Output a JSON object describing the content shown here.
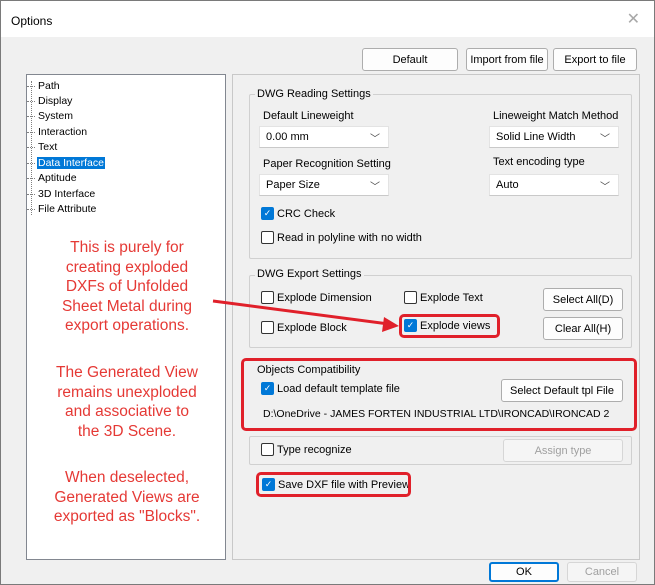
{
  "window": {
    "title": "Options"
  },
  "toolbar": {
    "default_label": "Default",
    "import_label": "Import from file",
    "export_label": "Export to file"
  },
  "tree": {
    "items": [
      {
        "label": "Path"
      },
      {
        "label": "Display"
      },
      {
        "label": "System"
      },
      {
        "label": "Interaction"
      },
      {
        "label": "Text"
      },
      {
        "label": "Data Interface"
      },
      {
        "label": "Aptitude"
      },
      {
        "label": "3D Interface"
      },
      {
        "label": "File Attribute"
      }
    ],
    "selected": "Data Interface"
  },
  "annotation": {
    "para1": [
      "This is purely for",
      "creating exploded",
      "DXFs of Unfolded",
      "Sheet Metal during",
      "export operations."
    ],
    "para2": [
      "The Generated View",
      "remains unexploded",
      "and associative to",
      "the 3D Scene."
    ],
    "para3": [
      "When deselected,",
      "Generated Views are",
      "exported as \"Blocks\"."
    ]
  },
  "dwg_reading": {
    "title": "DWG Reading Settings",
    "lineweight_label": "Default Lineweight",
    "lineweight_value": "0.00 mm",
    "match_label": "Lineweight Match Method",
    "match_value": "Solid Line Width",
    "paper_label": "Paper Recognition Setting",
    "paper_value": "Paper Size",
    "encoding_label": "Text encoding type",
    "encoding_value": "Auto",
    "crc_label": "CRC Check",
    "crc_checked": true,
    "polyline_label": "Read in polyline with no width",
    "polyline_checked": false
  },
  "dwg_export": {
    "title": "DWG Export Settings",
    "explode_dimension": "Explode Dimension",
    "explode_text": "Explode Text",
    "explode_block": "Explode Block",
    "explode_views": "Explode views",
    "explode_views_checked": true,
    "select_all": "Select All(D)",
    "clear_all": "Clear All(H)"
  },
  "objects_compat": {
    "title": "Objects Compatibility",
    "load_template_label": "Load default template file",
    "load_template_checked": true,
    "select_tpl_button": "Select Default tpl File",
    "template_path": "D:\\OneDrive - JAMES FORTEN INDUSTRIAL LTD\\IRONCAD\\IRONCAD 2"
  },
  "type_recognize": {
    "label": "Type recognize",
    "assign_button": "Assign type"
  },
  "save_dxf": {
    "label": "Save DXF file with Preview",
    "checked": true
  },
  "footer": {
    "ok_label": "OK",
    "cancel_label": "Cancel"
  },
  "colors": {
    "accent": "#0078d7",
    "annotation_red": "#e53935",
    "highlight_box": "#e0202a"
  },
  "icons": {
    "close": "close-icon",
    "dropdown": "chevron-down-icon",
    "check": "checkmark-icon"
  }
}
